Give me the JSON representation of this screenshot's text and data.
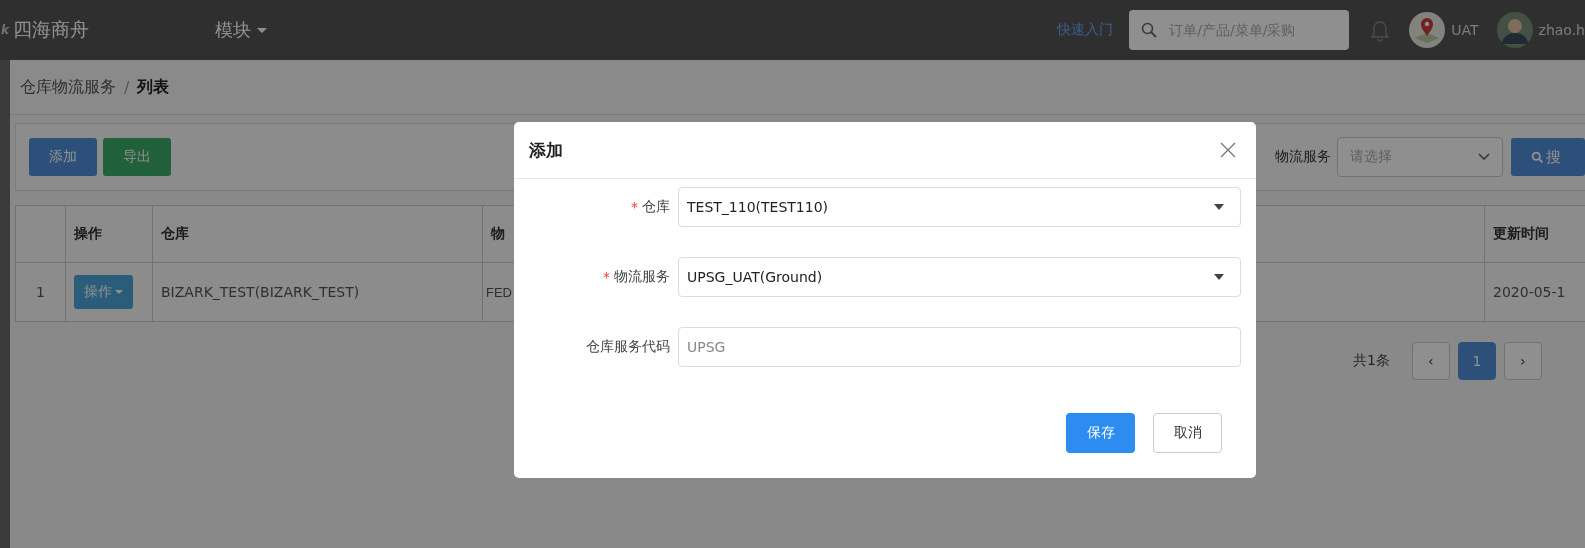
{
  "header": {
    "logo_text": "k",
    "brand": "四海商舟",
    "module_menu": "模块",
    "quick_link": "快速入门",
    "search": {
      "placeholder": "订单/产品/菜单/采购"
    },
    "env_label": "UAT",
    "user_name": "zhao.h"
  },
  "breadcrumb": {
    "items": [
      "仓库物流服务",
      "列表"
    ],
    "separator": "/"
  },
  "toolbar": {
    "buttons": [
      {
        "label": "添加",
        "kind": "primary"
      },
      {
        "label": "导出",
        "kind": "success"
      }
    ],
    "filter": {
      "label": "物流服务",
      "placeholder": "请选择"
    },
    "search_button": "搜"
  },
  "table": {
    "columns": [
      "",
      "操作",
      "仓库",
      "物",
      "更新时间"
    ],
    "rows": [
      {
        "index": "1",
        "action": "操作",
        "warehouse": "BIZARK_TEST(BIZARK_TEST)",
        "column_4": "FED",
        "updated": "2020-05-1"
      }
    ]
  },
  "pagination": {
    "total": "共1条",
    "prev": "‹",
    "pages": [
      {
        "label": "1",
        "selected": true
      }
    ],
    "next": "›"
  },
  "dialog": {
    "title": "添加",
    "fields": [
      {
        "label": "仓库",
        "required_mark": "*",
        "kind": "select",
        "value": "TEST_110(TEST110)"
      },
      {
        "label": "物流服务",
        "required_mark": "*",
        "kind": "select",
        "value": "UPSG_UAT(Ground)"
      },
      {
        "label": "仓库服务代码",
        "kind": "input",
        "placeholder": "UPSG"
      }
    ],
    "buttons": [
      {
        "label": "保存",
        "kind": "primary"
      },
      {
        "label": "取消",
        "kind": "default"
      }
    ]
  }
}
